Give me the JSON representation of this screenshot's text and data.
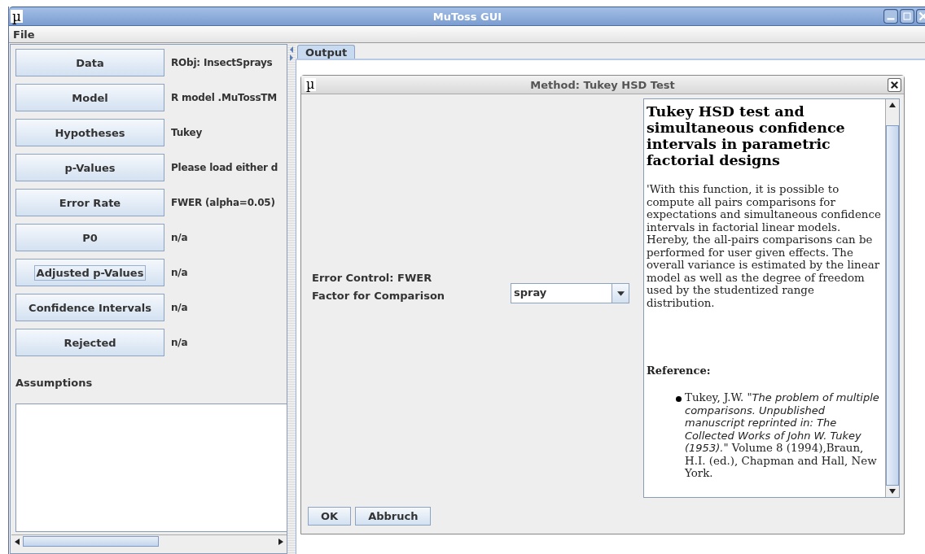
{
  "window": {
    "icon": "µ",
    "title": "MuToss GUI"
  },
  "menu": [
    "File"
  ],
  "sidebar": {
    "rows": [
      {
        "label": "Data",
        "value": "RObj: InsectSprays",
        "focused": false
      },
      {
        "label": "Model",
        "value": "R model .MuTossTM",
        "focused": false
      },
      {
        "label": "Hypotheses",
        "value": "Tukey",
        "focused": false
      },
      {
        "label": "p-Values",
        "value": "Please load either d",
        "focused": false
      },
      {
        "label": "Error Rate",
        "value": "FWER (alpha=0.05)",
        "focused": false
      },
      {
        "label": "P0",
        "value": "n/a",
        "focused": false
      },
      {
        "label": "Adjusted p-Values",
        "value": "n/a",
        "focused": true
      },
      {
        "label": "Confidence Intervals",
        "value": "n/a",
        "focused": false
      },
      {
        "label": "Rejected",
        "value": "n/a",
        "focused": false
      }
    ],
    "assumptions_label": "Assumptions"
  },
  "tabs": [
    {
      "label": "Output",
      "selected": true
    }
  ],
  "dialog": {
    "icon": "µ",
    "title": "Method: Tukey HSD Test",
    "error_control": "Error Control: FWER",
    "factor_label": "Factor for Comparison",
    "factor_value": "spray",
    "help": {
      "heading": "Tukey HSD test and simultaneous confidence intervals in parametric factorial designs",
      "description": "'With this function, it is possible to compute all pairs comparisons for expectations and simultaneous confidence intervals in factorial linear models. Hereby, the all-pairs comparisons can be performed for user given effects. The overall variance is estimated by the linear model as well as the degree of freedom used by the studentized range distribution.",
      "reference_heading": "Reference:",
      "references": [
        "Tukey, J.W. \"*The problem of multiple comparisons. Unpublished manuscript reprinted in: The Collected Works of John W. Tukey (1953).*\" Volume 8 (1994),Braun, H.I. (ed.), Chapman and Hall, New York."
      ]
    },
    "buttons": [
      "OK",
      "Abbruch"
    ]
  }
}
